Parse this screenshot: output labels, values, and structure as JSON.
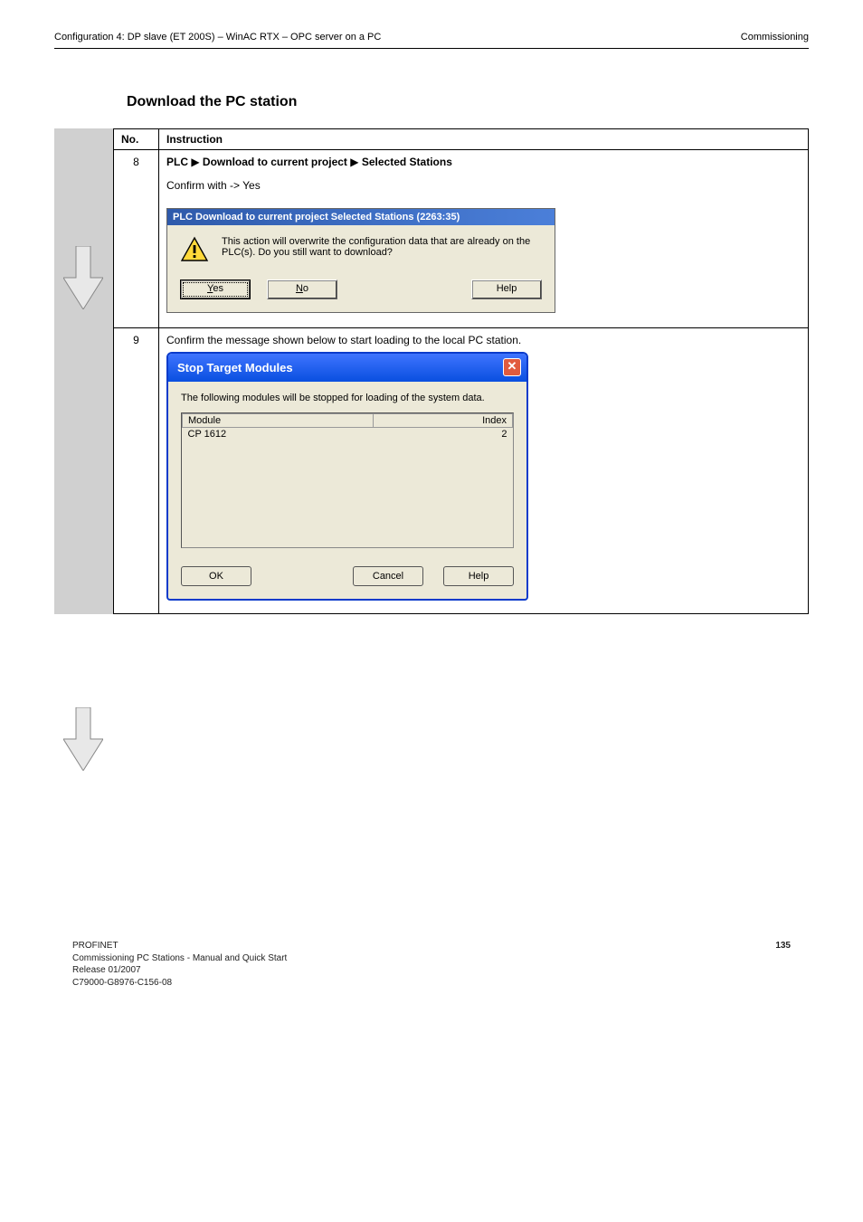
{
  "header": {
    "left": "Configuration 4: DP slave (ET 200S) – WinAC RTX – OPC server on a PC",
    "right": "Commissioning"
  },
  "section_title": "Download the PC station",
  "table": {
    "col_no": "No.",
    "col_instr": "Instruction",
    "rows": [
      {
        "no": "8",
        "line1_pre": "PLC ",
        "line1_mid": " Download to current project ",
        "line1_post": " Selected Stations",
        "line2": "Confirm with -> Yes"
      },
      {
        "no": "9",
        "line": "Confirm the message shown below to start loading to the local PC station."
      }
    ]
  },
  "dialog1": {
    "title": "PLC Download to current project Selected Stations (2263:35)",
    "message": "This action will overwrite the configuration data that are already on the PLC(s). Do you still want to download?",
    "btn_yes_pre": "",
    "btn_yes_u": "Y",
    "btn_yes_post": "es",
    "btn_no_u": "N",
    "btn_no_post": "o",
    "btn_help": "Help"
  },
  "dialog2": {
    "title": "Stop Target Modules",
    "message": "The following modules will be stopped for loading of the system data.",
    "col_module": "Module",
    "col_index": "Index",
    "row_module": "CP 1612",
    "row_index": "2",
    "btn_ok": "OK",
    "btn_cancel": "Cancel",
    "btn_help": "Help"
  },
  "footer": {
    "left_line1": "PROFINET",
    "left_line2": "Commissioning PC Stations - Manual and Quick Start",
    "left_line3": "Release 01/2007",
    "left_line4": "C79000-G8976-C156-08",
    "page": "135"
  }
}
